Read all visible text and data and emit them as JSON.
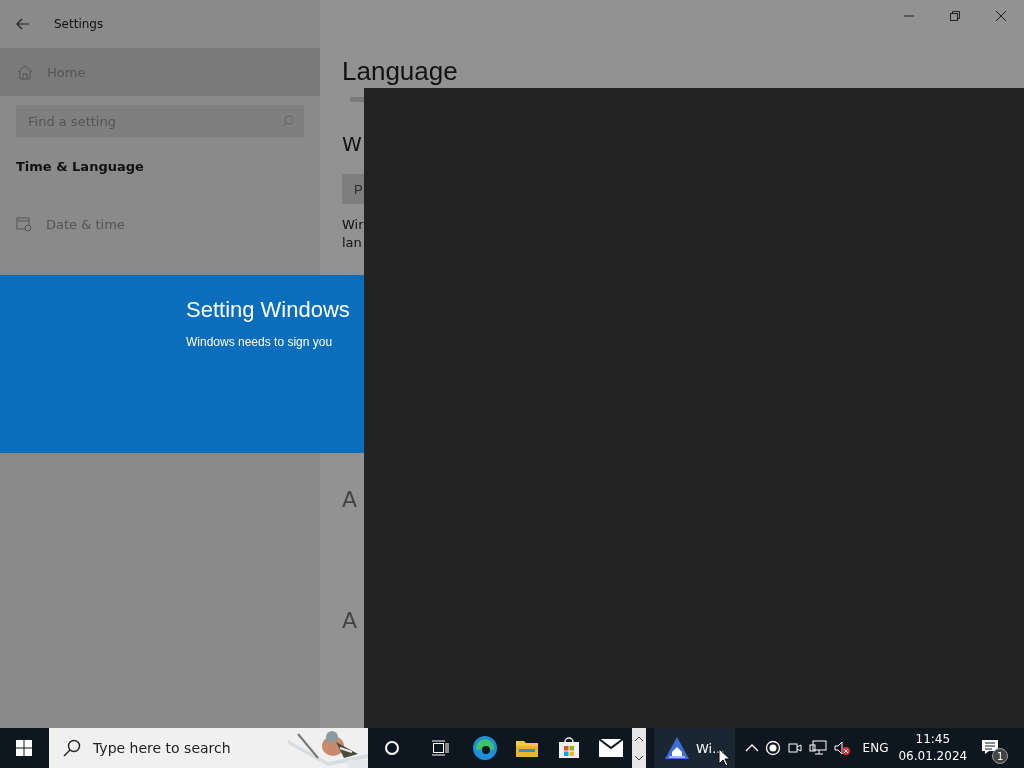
{
  "window": {
    "title": "Settings"
  },
  "sidebar": {
    "home": "Home",
    "search": {
      "placeholder": "Find a setting"
    },
    "section": "Time & Language",
    "items": [
      {
        "label": "Date & time"
      }
    ]
  },
  "content": {
    "title": "Language",
    "heading": "W",
    "button": "P",
    "text_lines": [
      "Wir",
      "lan"
    ],
    "language_icons": [
      "A",
      "A"
    ]
  },
  "banner": {
    "title": "Setting Windows",
    "message": "Windows needs to sign you"
  },
  "taskbar": {
    "search": {
      "placeholder": "Type here to search"
    },
    "app": {
      "label": "Wi..."
    },
    "language": "ENG",
    "time": "11:45",
    "date": "06.01.2024",
    "notifications": "1"
  }
}
